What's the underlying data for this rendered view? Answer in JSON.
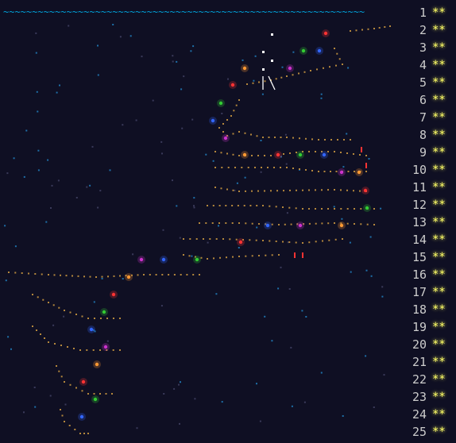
{
  "calendar": {
    "sea_line": "~~~~~~~~~~~~~~~~~~~~~~~~~~~~~~~~~~~~~~~~~~~~~~~~~~~~~~~~~~~~~~~",
    "days": [
      {
        "day": "1",
        "stars": "**"
      },
      {
        "day": "2",
        "stars": "**"
      },
      {
        "day": "3",
        "stars": "**"
      },
      {
        "day": "4",
        "stars": "**"
      },
      {
        "day": "5",
        "stars": "**"
      },
      {
        "day": "6",
        "stars": "**"
      },
      {
        "day": "7",
        "stars": "**"
      },
      {
        "day": "8",
        "stars": "**"
      },
      {
        "day": "9",
        "stars": "**"
      },
      {
        "day": "10",
        "stars": "**"
      },
      {
        "day": "11",
        "stars": "**"
      },
      {
        "day": "12",
        "stars": "**"
      },
      {
        "day": "13",
        "stars": "**"
      },
      {
        "day": "14",
        "stars": "**"
      },
      {
        "day": "15",
        "stars": "**"
      },
      {
        "day": "16",
        "stars": "**"
      },
      {
        "day": "17",
        "stars": "**"
      },
      {
        "day": "18",
        "stars": "**"
      },
      {
        "day": "19",
        "stars": "**"
      },
      {
        "day": "20",
        "stars": "**"
      },
      {
        "day": "21",
        "stars": "**"
      },
      {
        "day": "22",
        "stars": "**"
      },
      {
        "day": "23",
        "stars": "**"
      },
      {
        "day": "24",
        "stars": "**"
      },
      {
        "day": "25",
        "stars": "**"
      }
    ]
  },
  "colors": {
    "background": "#0f0f23",
    "star": "#ffff66",
    "sea": "#00a0d8",
    "dots": "#b4873c",
    "lights": [
      "#ff3333",
      "#33cc33",
      "#3366ff",
      "#cc33cc",
      "#ff9933"
    ]
  }
}
